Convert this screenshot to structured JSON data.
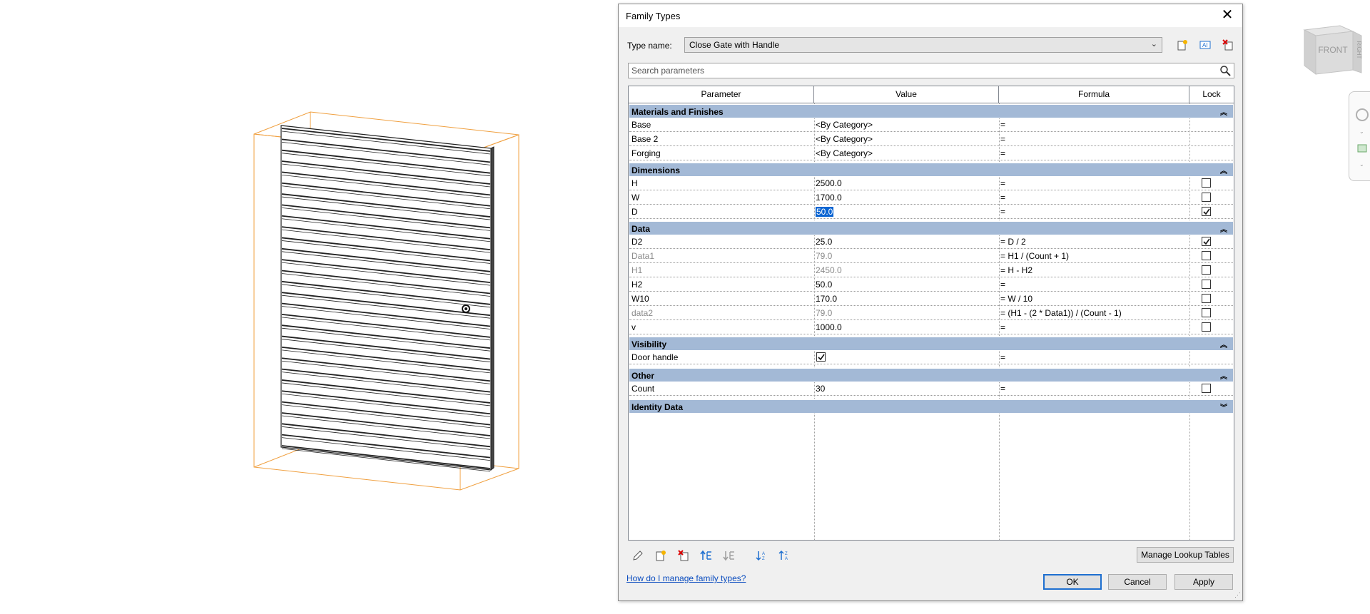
{
  "dialog": {
    "title": "Family Types",
    "type_name_label": "Type name:",
    "type_name_value": "Close Gate with Handle",
    "search_placeholder": "Search parameters"
  },
  "columns": [
    "Parameter",
    "Value",
    "Formula",
    "Lock"
  ],
  "groups": {
    "materials": {
      "label": "Materials and Finishes",
      "toggle": "⌃⌃",
      "rows": [
        {
          "param": "Base",
          "value": "<By Category>",
          "formula": "="
        },
        {
          "param": "Base 2",
          "value": "<By Category>",
          "formula": "="
        },
        {
          "param": "Forging",
          "value": "<By Category>",
          "formula": "="
        }
      ]
    },
    "dimensions": {
      "label": "Dimensions",
      "rows": [
        {
          "param": "H",
          "value": "2500.0",
          "formula": "=",
          "lock": false
        },
        {
          "param": "W",
          "value": "1700.0",
          "formula": "=",
          "lock": false
        },
        {
          "param": "D",
          "value": "50.0",
          "formula": "=",
          "lock": true
        }
      ]
    },
    "data": {
      "label": "Data",
      "rows": [
        {
          "param": "D2",
          "value": "25.0",
          "formula": "= D / 2",
          "lock": true
        },
        {
          "param": "Data1",
          "value": "79.0",
          "formula": "= H1 / (Count + 1)",
          "lock": false
        },
        {
          "param": "H1",
          "value": "2450.0",
          "formula": "= H - H2",
          "lock": false
        },
        {
          "param": "H2",
          "value": "50.0",
          "formula": "=",
          "lock": false
        },
        {
          "param": "W10",
          "value": "170.0",
          "formula": "= W / 10",
          "lock": false
        },
        {
          "param": "data2",
          "value": "79.0",
          "formula": "= (H1 - (2 * Data1)) / (Count - 1)",
          "lock": false
        },
        {
          "param": "v",
          "value": "1000.0",
          "formula": "=",
          "lock": false
        }
      ]
    },
    "visibility": {
      "label": "Visibility",
      "rows": [
        {
          "param": "Door handle",
          "value_checked": true,
          "formula": "="
        }
      ]
    },
    "other": {
      "label": "Other",
      "rows": [
        {
          "param": "Count",
          "value": "30",
          "formula": "=",
          "lock": false
        }
      ]
    },
    "identity": {
      "label": "Identity Data"
    }
  },
  "buttons": {
    "manage_lookup": "Manage Lookup Tables",
    "ok": "OK",
    "cancel": "Cancel",
    "apply": "Apply"
  },
  "help_link": "How do I manage family types?",
  "viewcube": {
    "front_label": "FRONT",
    "side_label": "RIGHT"
  },
  "colors": {
    "group_header": "#a3b9d6",
    "selection": "#0a64d2",
    "bounding_box": "#f0a040",
    "link": "#0a4cbf"
  }
}
